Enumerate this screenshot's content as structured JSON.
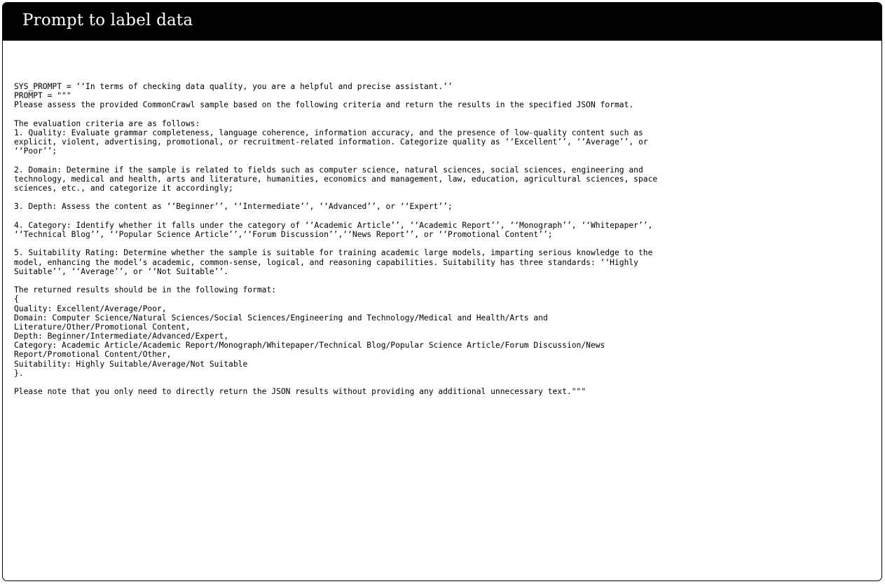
{
  "title": "Prompt to label data",
  "lines": [
    "SYS_PROMPT = ‘‘In terms of checking data quality, you are a helpful and precise assistant.’’",
    "PROMPT = \"\"\"",
    "Please assess the provided CommonCrawl sample based on the following criteria and return the results in the specified JSON format.",
    "",
    "The evaluation criteria are as follows:",
    "1. Quality: Evaluate grammar completeness, language coherence, information accuracy, and the presence of low-quality content such as",
    "explicit, violent, advertising, promotional, or recruitment-related information. Categorize quality as ‘‘Excellent’’, ‘‘Average’’, or",
    "‘‘Poor’’;",
    "",
    "2. Domain: Determine if the sample is related to fields such as computer science, natural sciences, social sciences, engineering and",
    "technology, medical and health, arts and literature, humanities, economics and management, law, education, agricultural sciences, space",
    "sciences, etc., and categorize it accordingly;",
    "",
    "3. Depth: Assess the content as ‘‘Beginner’’, ‘‘Intermediate’’, ‘‘Advanced’’, or ‘‘Expert’’;",
    "",
    "4. Category: Identify whether it falls under the category of ‘‘Academic Article’’, ‘‘Academic Report’’, ‘‘Monograph’’, ‘‘Whitepaper’’,",
    "‘‘Technical Blog’’, ‘‘Popular Science Article’’,‘‘Forum Discussion’’,‘‘News Report’’, or ‘‘Promotional Content’’;",
    "",
    "5. Suitability Rating: Determine whether the sample is suitable for training academic large models, imparting serious knowledge to the",
    "model, enhancing the model’s academic, common-sense, logical, and reasoning capabilities. Suitability has three standards: ‘‘Highly",
    "Suitable’’, ‘‘Average’’, or ‘‘Not Suitable’’.",
    "",
    "The returned results should be in the following format:",
    "{",
    "Quality: Excellent/Average/Poor,",
    "Domain: Computer Science/Natural Sciences/Social Sciences/Engineering and Technology/Medical and Health/Arts and",
    "Literature/Other/Promotional Content,",
    "Depth: Beginner/Intermediate/Advanced/Expert,",
    "Category: Academic Article/Academic Report/Monograph/Whitepaper/Technical Blog/Popular Science Article/Forum Discussion/News",
    "Report/Promotional Content/Other,",
    "Suitability: Highly Suitable/Average/Not Suitable",
    "}.",
    "",
    "Please note that you only need to directly return the JSON results without providing any additional unnecessary text.\"\"\""
  ]
}
